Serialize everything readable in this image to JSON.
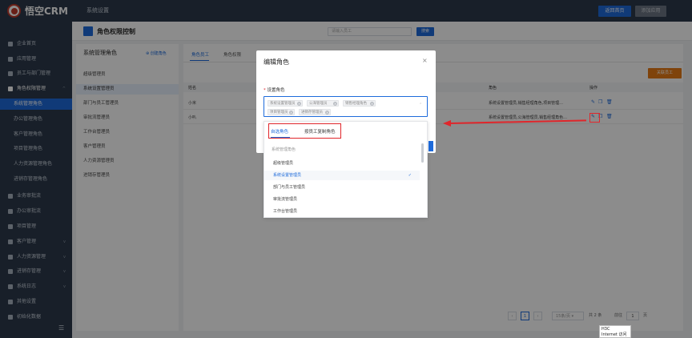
{
  "app": {
    "logo_text": "悟空CRM",
    "top_menu": "系统设置",
    "btn_return": "返回首页",
    "btn_add_app": "添加应用"
  },
  "sidebar": {
    "items": [
      {
        "label": "企业首页",
        "icon": "home-icon"
      },
      {
        "label": "应用管理",
        "icon": "apps-icon"
      },
      {
        "label": "员工与部门管理",
        "icon": "users-icon"
      },
      {
        "label": "角色权限管理",
        "icon": "user-role-icon",
        "caret": "^"
      },
      {
        "label": "系统管理角色",
        "active": true
      },
      {
        "label": "办公管理角色"
      },
      {
        "label": "客户管理角色"
      },
      {
        "label": "项目管理角色"
      },
      {
        "label": "人力资源管理角色"
      },
      {
        "label": "进销存管理角色"
      },
      {
        "label": "业务审批流",
        "icon": "approval-icon"
      },
      {
        "label": "办公审批流",
        "icon": "office-icon"
      },
      {
        "label": "项目管理",
        "icon": "project-icon"
      },
      {
        "label": "客户管理",
        "icon": "customer-icon",
        "caret": "v"
      },
      {
        "label": "人力资源管理",
        "icon": "hr-icon",
        "caret": "v"
      },
      {
        "label": "进销存管理",
        "icon": "inventory-icon",
        "caret": "v"
      },
      {
        "label": "系统日志",
        "icon": "log-icon",
        "caret": "v"
      },
      {
        "label": "其他设置",
        "icon": "gear-icon"
      },
      {
        "label": "初始化数据",
        "icon": "data-icon"
      }
    ]
  },
  "header": {
    "title": "角色权限控制",
    "search_placeholder": "请输入员工",
    "search_btn": "搜索"
  },
  "left_panel": {
    "title": "系统管理角色",
    "create": "创建角色",
    "roles": [
      "超级管理员",
      "系统设置管理员",
      "部门与员工管理员",
      "审批流管理员",
      "工作台管理员",
      "客户管理员",
      "人力资源管理员",
      "进销存管理员"
    ]
  },
  "right_panel": {
    "tabs": [
      "角色员工",
      "角色权限"
    ],
    "add_employee": "关联员工",
    "columns": [
      "姓名",
      "角色",
      "操作"
    ],
    "rows": [
      {
        "name": "小米",
        "roles": "系统设置管理员,销售经理角色,项目管理..."
      },
      {
        "name": "小叭",
        "roles": "系统设置管理员,公海管理员,销售经理角色..."
      }
    ]
  },
  "pagination": {
    "page": "1",
    "page_size": "15条/页",
    "total": "共 2 条",
    "goto_label": "前往",
    "goto_value": "1",
    "page_unit": "页"
  },
  "modal": {
    "title": "编辑角色",
    "close": "×",
    "field_label": "设置角色",
    "required": "*",
    "chips": [
      "系统设置管理员",
      "公海管理员",
      "销售经理角色",
      "项目管理员",
      "进销存管理员"
    ],
    "caret": "⌃"
  },
  "dropdown": {
    "tabs": [
      "自选角色",
      "按员工复制角色"
    ],
    "group": "系统管理角色",
    "items": [
      {
        "label": "超级管理员"
      },
      {
        "label": "系统设置管理员",
        "selected": true
      },
      {
        "label": "部门与员工管理员"
      },
      {
        "label": "审批流管理员"
      },
      {
        "label": "工作台管理员"
      }
    ],
    "check": "✓"
  },
  "tooltip": {
    "line1": "H3C",
    "line2": "Internet 访问"
  }
}
